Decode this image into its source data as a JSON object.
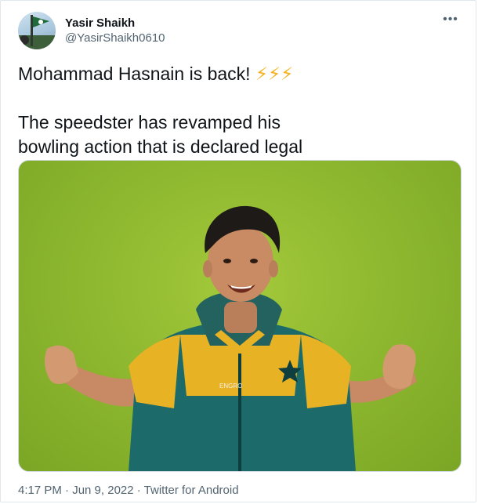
{
  "tweet": {
    "author": {
      "display_name": "Yasir Shaikh",
      "handle": "@YasirShaikh0610"
    },
    "more_icon": "more-horizontal-icon",
    "text_line1": "Mohammad Hasnain is back! ",
    "emoji": "⚡⚡⚡",
    "text_rest": "\n\n The speedster has revamped his\nbowling action that is declared legal",
    "media": {
      "jersey_badge_text": "ENGRO"
    },
    "timestamp": "4:17 PM · Jun 9, 2022 · ",
    "source": "Twitter for Android"
  },
  "colors": {
    "text": "#0f1419",
    "muted": "#536471",
    "bolt": "#f6b21e",
    "grass": "#8fb930",
    "jersey_teal": "#1c6b6a",
    "jersey_yellow": "#e8b225"
  }
}
